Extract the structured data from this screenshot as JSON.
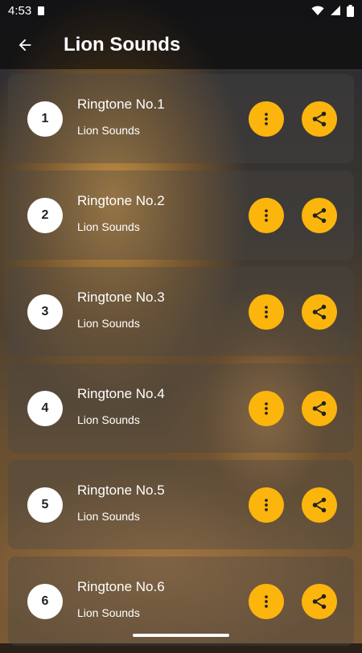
{
  "status": {
    "time": "4:53",
    "icons": [
      "sd-card-icon",
      "wifi-icon",
      "signal-icon",
      "battery-icon"
    ]
  },
  "appbar": {
    "title": "Lion Sounds",
    "back_icon": "arrow-back-icon"
  },
  "colors": {
    "accent": "#FBB50C",
    "card": "#464646"
  },
  "items": [
    {
      "number": "1",
      "name": "Ringtone No.1",
      "subtitle": "Lion Sounds"
    },
    {
      "number": "2",
      "name": "Ringtone No.2",
      "subtitle": "Lion Sounds"
    },
    {
      "number": "3",
      "name": "Ringtone No.3",
      "subtitle": "Lion Sounds"
    },
    {
      "number": "4",
      "name": "Ringtone No.4",
      "subtitle": "Lion Sounds"
    },
    {
      "number": "5",
      "name": "Ringtone No.5",
      "subtitle": "Lion Sounds"
    },
    {
      "number": "6",
      "name": "Ringtone No.6",
      "subtitle": "Lion Sounds"
    }
  ]
}
